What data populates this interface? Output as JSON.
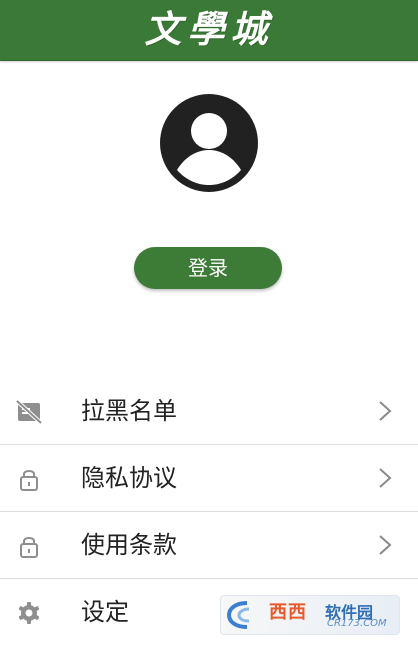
{
  "header": {
    "title": "文學城",
    "color": "#3b7a36"
  },
  "profile": {
    "avatar_icon": "user-avatar-icon",
    "login_label": "登录",
    "button_color": "#3c7c36"
  },
  "menu": {
    "items": [
      {
        "label": "拉黑名单",
        "icon": "blocked-card-icon",
        "has_chevron": true
      },
      {
        "label": "隐私协议",
        "icon": "lock-icon",
        "has_chevron": true
      },
      {
        "label": "使用条款",
        "icon": "lock-icon",
        "has_chevron": true
      },
      {
        "label": "设定",
        "icon": "gear-icon",
        "has_chevron": false
      }
    ]
  },
  "watermark": {
    "name": "西西",
    "subtitle": "软件园",
    "url": "CR173.COM"
  }
}
